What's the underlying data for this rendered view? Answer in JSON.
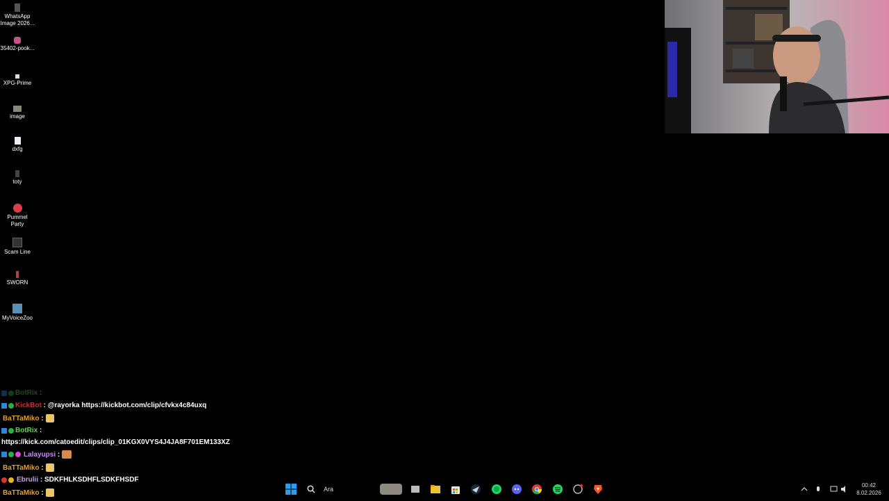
{
  "desktop": {
    "icons": [
      {
        "label": "WhatsApp Image 2026...",
        "icon": "image-file-icon"
      },
      {
        "label": "35402-pook...",
        "icon": "image-file-icon"
      },
      {
        "label": "XPG-Prime",
        "icon": "app-icon"
      },
      {
        "label": "image",
        "icon": "image-file-icon"
      },
      {
        "label": "dxfg",
        "icon": "document-icon"
      },
      {
        "label": "toty",
        "icon": "app-icon"
      },
      {
        "label": "Pummel Party",
        "icon": "game-icon"
      },
      {
        "label": "Scam Line",
        "icon": "game-icon"
      },
      {
        "label": "SWORN",
        "icon": "game-icon"
      },
      {
        "label": "MyVoiceZoo",
        "icon": "app-icon"
      }
    ]
  },
  "webcam": {
    "description_icon": "webcam-feed"
  },
  "chat": {
    "messages": [
      {
        "user": "BotRix",
        "user_color": "#3a5a2a",
        "text": ""
      },
      {
        "user": "KickBot",
        "user_color": "#d92b2b",
        "text": "@rayorka https://kickbot.com/clip/cfvkx4c84uxq"
      },
      {
        "user": "BaTTaMiko",
        "user_color": "#e8a020",
        "text": ""
      },
      {
        "user": "BotRix",
        "user_color": "#5ad646",
        "text": ""
      },
      {
        "user": "",
        "user_color": "#ffffff",
        "text": "https://kick.com/catoedit/clips/clip_01KGX0VYS4J4JA8F701EM133XZ"
      },
      {
        "user": "Lalayupsi",
        "user_color": "#c58ff0",
        "text": ""
      },
      {
        "user": "BaTTaMiko",
        "user_color": "#e8a020",
        "text": ""
      },
      {
        "user": "Ebrulii",
        "user_color": "#c5a0e0",
        "text": "SDKFHLKSDHFLSDKFHSDF"
      },
      {
        "user": "BaTTaMiko",
        "user_color": "#e8a020",
        "text": ""
      }
    ]
  },
  "taskbar": {
    "search_placeholder": "Ara",
    "apps": [
      "start-icon",
      "file-explorer-icon",
      "folder-icon",
      "store-icon",
      "steam-icon",
      "whatsapp-icon",
      "discord-icon",
      "chrome-icon",
      "spotify-icon",
      "settings-icon",
      "brave-icon"
    ],
    "time": "00:42",
    "date": "8.02.2026"
  },
  "colors": {
    "background": "#000000",
    "chat_text": "#ffffff"
  }
}
